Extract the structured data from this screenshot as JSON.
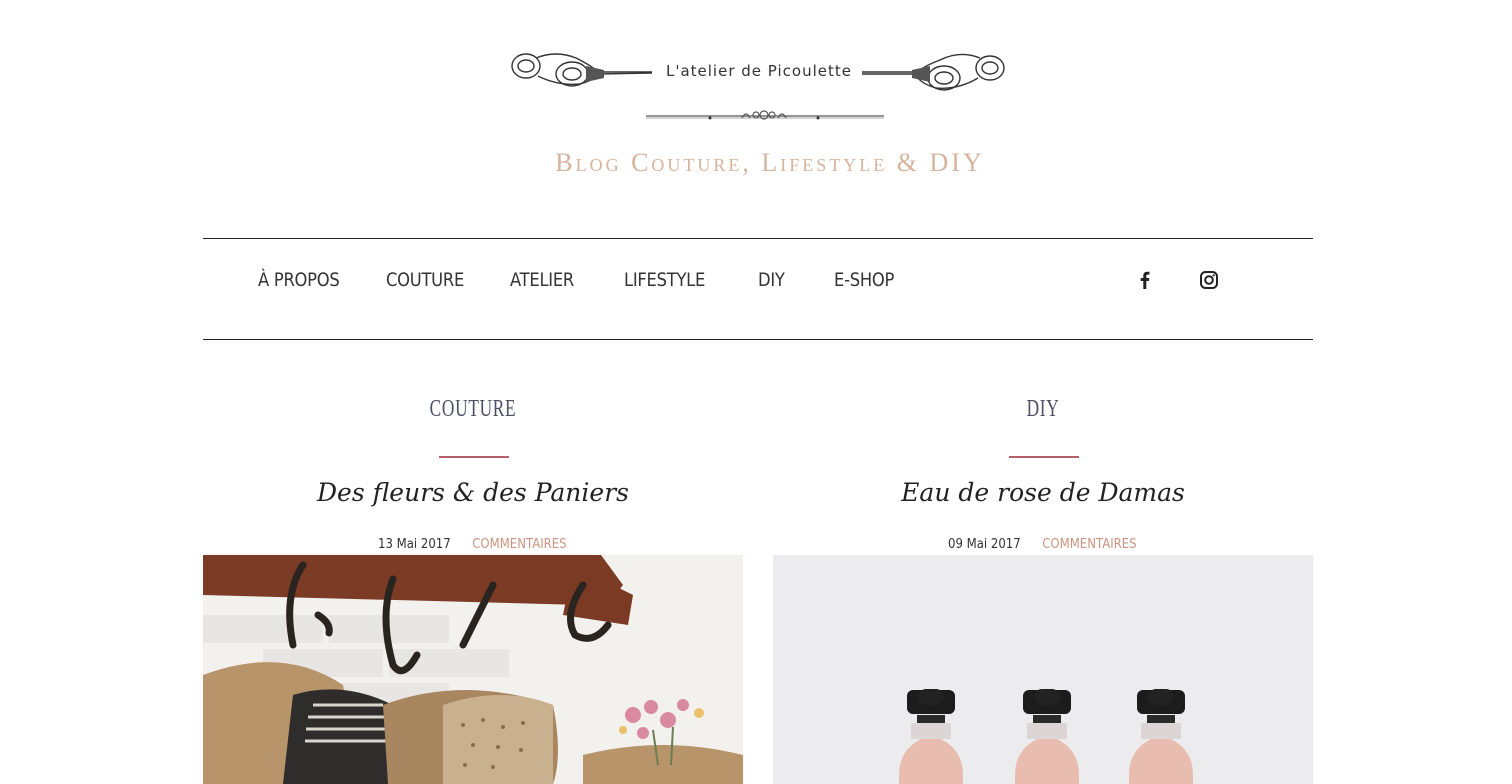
{
  "site": {
    "logo_text": "L'atelier  de  Picoulette",
    "tagline": "Blog Couture, Lifestyle & DIY"
  },
  "nav": {
    "items": [
      {
        "label": "À PROPOS"
      },
      {
        "label": "COUTURE"
      },
      {
        "label": "ATELIER"
      },
      {
        "label": "LIFESTYLE"
      },
      {
        "label": "DIY"
      },
      {
        "label": "E-SHOP"
      }
    ],
    "social": [
      {
        "icon": "facebook-icon"
      },
      {
        "icon": "instagram-icon"
      }
    ]
  },
  "posts": [
    {
      "category": "COUTURE",
      "title": "Des fleurs & des Paniers",
      "date": "13 Mai 2017",
      "comments_label": "COMMENTAIRES",
      "image": "hanging-burlap-baskets-photo"
    },
    {
      "category": "DIY",
      "title": "Eau de rose de Damas",
      "date": "09 Mai 2017",
      "comments_label": "COMMENTAIRES",
      "image": "rose-water-dropper-bottles-photo"
    }
  ],
  "colors": {
    "accent_rule": "#b5616b",
    "tagline": "#d6b39c",
    "comments_link": "#c9957f",
    "category": "#4a4f63"
  }
}
